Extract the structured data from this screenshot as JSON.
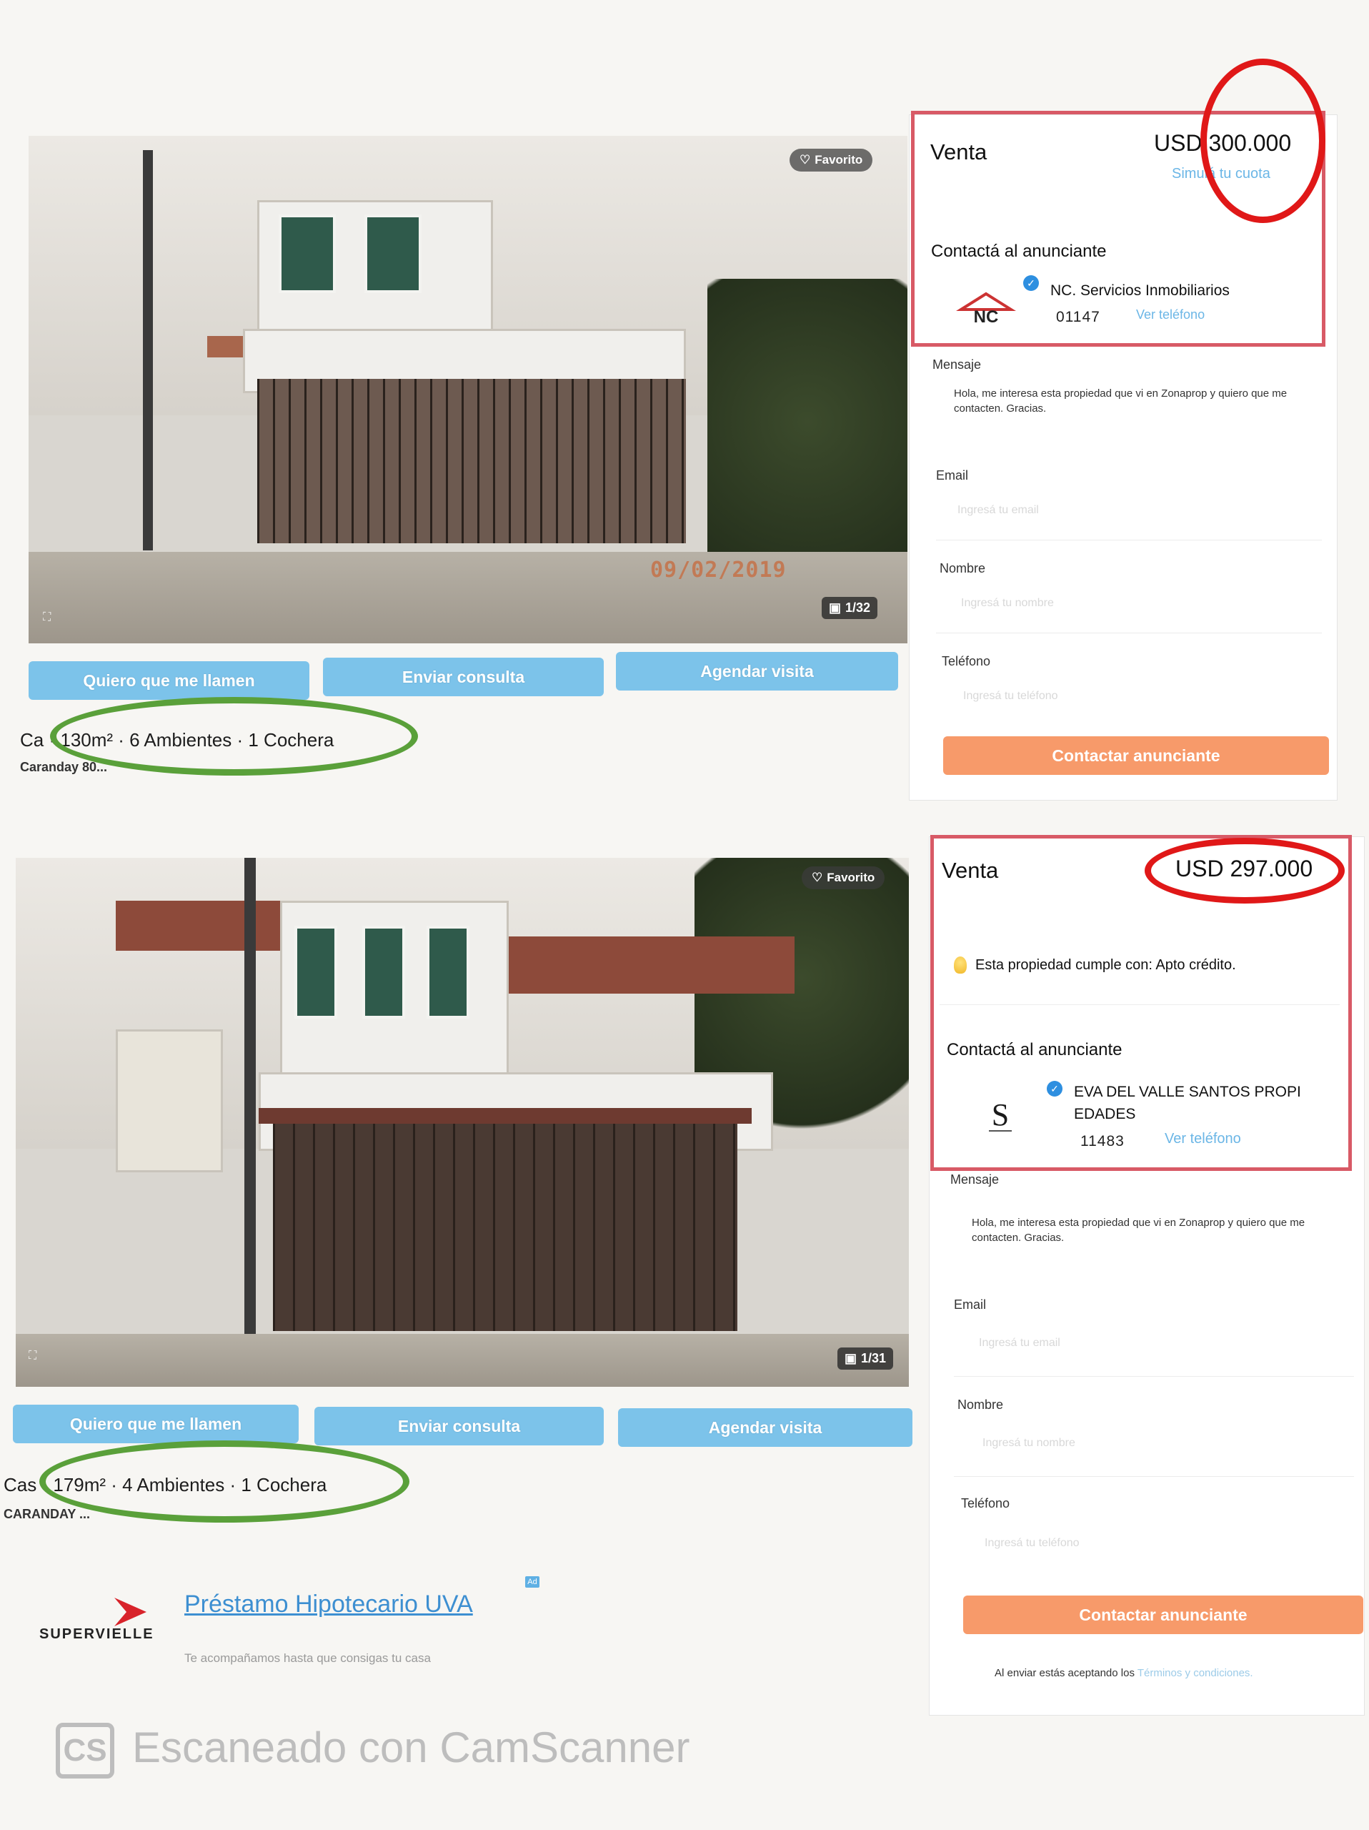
{
  "listings": [
    {
      "favorite_label": "Favorito",
      "date_stamp": "09/02/2019",
      "photo_count": "1/32",
      "buttons": {
        "call_me": "Quiero que me llamen",
        "send_query": "Enviar consulta",
        "schedule": "Agendar visita"
      },
      "features_prefix": "Ca",
      "features": "· 130m² · 6 Ambientes · 1 Cochera",
      "address": "Caranday 80...",
      "panel": {
        "operation": "Venta",
        "price": "USD 300.000",
        "quota_link": "Simulá tu cuota",
        "contact_heading": "Contactá al anunciante",
        "agency_name": "NC. Servicios Inmobiliarios",
        "agency_logo_text": "NC",
        "phone": "01147",
        "show_phone": "Ver teléfono",
        "message_label": "Mensaje",
        "message_text": "Hola, me interesa esta propiedad que vi en Zonaprop y quiero que me contacten. Gracias.",
        "email_label": "Email",
        "email_placeholder": "Ingresá tu email",
        "name_label": "Nombre",
        "name_placeholder": "Ingresá tu nombre",
        "phone_label": "Teléfono",
        "phone_placeholder": "Ingresá tu teléfono",
        "contact_button": "Contactar anunciante"
      }
    },
    {
      "favorite_label": "Favorito",
      "photo_count": "1/31",
      "buttons": {
        "call_me": "Quiero que me llamen",
        "send_query": "Enviar consulta",
        "schedule": "Agendar visita"
      },
      "features_prefix": "Cas",
      "features": "· 179m² · 4 Ambientes · 1 Cochera",
      "address": "CARANDAY ...",
      "panel": {
        "operation": "Venta",
        "price": "USD 297.000",
        "apto_text": "Esta propiedad cumple con: Apto crédito.",
        "contact_heading": "Contactá al anunciante",
        "agency_name_line1": "EVA DEL VALLE SANTOS PROPI",
        "agency_name_line2": "EDADES",
        "agency_logo_text": "S",
        "phone": "11483",
        "show_phone": "Ver teléfono",
        "message_label": "Mensaje",
        "message_text": "Hola, me interesa esta propiedad que vi en Zonaprop y quiero que me contacten. Gracias.",
        "email_label": "Email",
        "email_placeholder": "Ingresá tu email",
        "name_label": "Nombre",
        "name_placeholder": "Ingresá tu nombre",
        "phone_label": "Teléfono",
        "phone_placeholder": "Ingresá tu teléfono",
        "contact_button": "Contactar anunciante",
        "terms_prefix": "Al enviar estás aceptando los",
        "terms_link": "Términos y condiciones."
      }
    }
  ],
  "ad": {
    "brand": "SUPERVIELLE",
    "title": "Préstamo Hipotecario UVA",
    "subtitle": "Te acompañamos hasta que consigas tu casa",
    "badge": "Ad"
  },
  "watermark": {
    "logo": "CS",
    "text": "Escaneado con CamScanner"
  },
  "colors": {
    "button_blue": "#7cc3ea",
    "button_orange": "#f79a6a",
    "highlight_red": "#e01818",
    "highlight_green": "#5aa03a",
    "panel_border": "#d85a66",
    "link_blue": "#6bb6e6"
  }
}
